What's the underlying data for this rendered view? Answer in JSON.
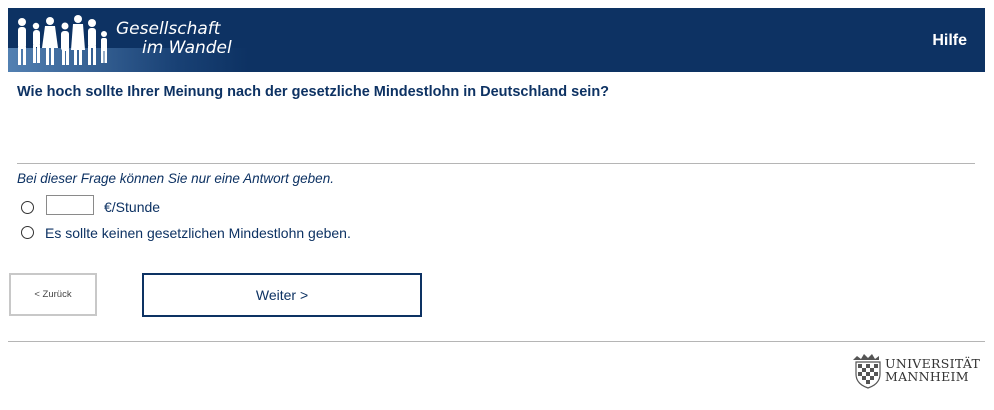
{
  "header": {
    "logo_line1": "Gesellschaft",
    "logo_line2": "im Wandel",
    "help_label": "Hilfe"
  },
  "question": {
    "text": "Wie hoch sollte Ihrer Meinung nach der gesetzliche Mindestlohn in Deutschland sein?",
    "instruction": "Bei dieser Frage können Sie nur eine Antwort geben.",
    "amount_value": "",
    "amount_unit": "€/Stunde",
    "option_no_wage": "Es sollte keinen gesetzlichen Mindestlohn geben."
  },
  "navigation": {
    "back_label": "< Zurück",
    "next_label": "Weiter >"
  },
  "footer": {
    "university_line1": "UNIVERSITÄT",
    "university_line2": "MANNHEIM"
  },
  "colors": {
    "brand": "#0d3263"
  }
}
